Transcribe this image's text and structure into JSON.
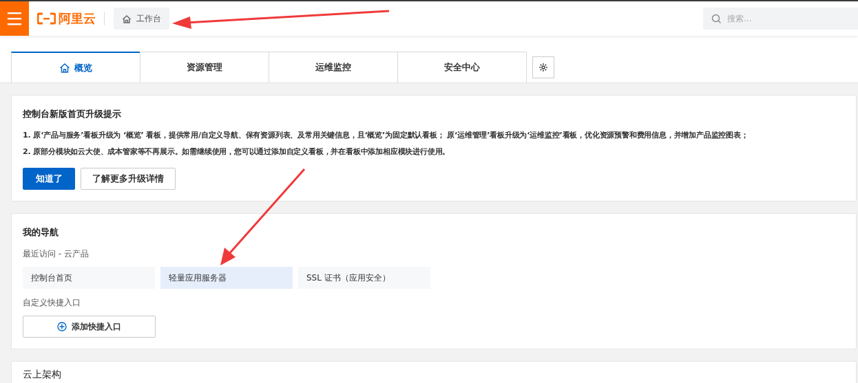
{
  "header": {
    "logo_text": "阿里云",
    "breadcrumb": "工作台",
    "search": {
      "placeholder": "搜索..."
    }
  },
  "tabs": [
    {
      "label": "概览",
      "selected": true
    },
    {
      "label": "资源管理",
      "selected": false
    },
    {
      "label": "运维监控",
      "selected": false
    },
    {
      "label": "安全中心",
      "selected": false
    }
  ],
  "notice": {
    "title": "控制台新版首页升级提示",
    "lines": [
      "1. 原‘产品与服务’看板升级为 ‘概览’ 看板，提供常用/自定义导航、保有资源列表、及常用关键信息，且‘概览’为固定默认看板； 原‘运维管理’看板升级为‘运维监控’看板，优化资源预警和费用信息，并增加产品监控图表；",
      "2. 原部分模块如云大使、成本管家等不再展示。如需继续使用，您可以通过添加自定义看板，并在看板中添加相应模块进行使用。"
    ],
    "buttons": [
      {
        "label": "知道了",
        "kind": "primary"
      },
      {
        "label": "了解更多升级详情",
        "kind": "secondary"
      }
    ]
  },
  "navigation": {
    "title": "我的导航",
    "recent_label": "最近访问 - 云产品",
    "recent_items": [
      {
        "label": "控制台首页",
        "selected": false
      },
      {
        "label": "轻量应用服务器",
        "selected": true
      },
      {
        "label": "SSL 证书（应用安全）",
        "selected": false
      }
    ],
    "custom_label": "自定义快捷入口",
    "add_button": "添加快捷入口"
  },
  "next_section": {
    "title": "云上架构"
  }
}
